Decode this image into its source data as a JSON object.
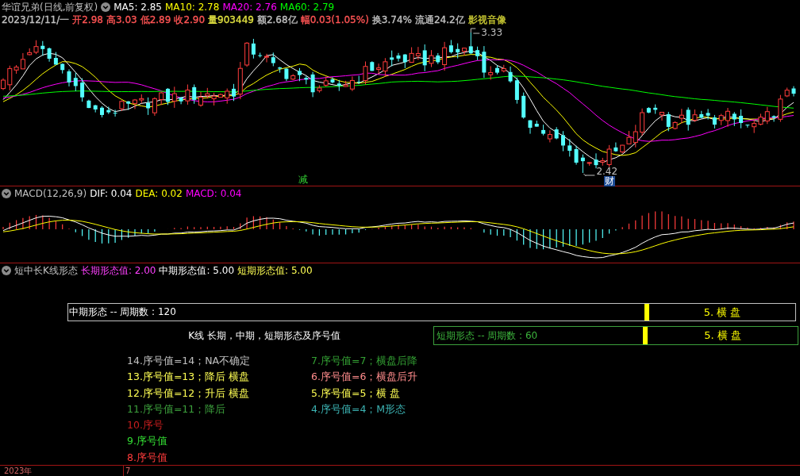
{
  "main_chart": {
    "title": "华谊兄弟(日线,前复权)",
    "indicators": [
      {
        "label": "MA5: 2.85",
        "color": "#ffffff"
      },
      {
        "label": "MA10: 2.78",
        "color": "#ffff00"
      },
      {
        "label": "MA20: 2.76",
        "color": "#ff00ff"
      },
      {
        "label": "MA60: 2.79",
        "color": "#00ff00"
      }
    ],
    "quote": [
      {
        "text": "2023/12/11/一",
        "color": "#c0c0c0"
      },
      {
        "text": "开2.98",
        "color": "#ff5454"
      },
      {
        "text": "高3.03",
        "color": "#ff5454"
      },
      {
        "text": "低2.89",
        "color": "#ff5454"
      },
      {
        "text": "收2.90",
        "color": "#ff5454"
      },
      {
        "text": "量903449",
        "color": "#e0e040"
      },
      {
        "text": "额2.68亿",
        "color": "#c0c0c0"
      },
      {
        "text": "幅0.03(1.05%)",
        "color": "#ff5454"
      },
      {
        "text": "换3.74%",
        "color": "#c0c0c0"
      },
      {
        "text": "流通24.2亿",
        "color": "#c0c0c0"
      },
      {
        "text": "影视音像",
        "color": "#c8c832"
      }
    ],
    "high_label": "3.33",
    "low_label": "2.42",
    "markers": [
      {
        "text": "减",
        "kind": "plain"
      },
      {
        "text": "财",
        "kind": "boxed"
      }
    ]
  },
  "macd": {
    "title": "MACD(12,26,9)",
    "values": [
      {
        "label": "DIF: 0.04",
        "color": "#ffffff"
      },
      {
        "label": "DEA: 0.02",
        "color": "#ffff00"
      },
      {
        "label": "MACD: 0.04",
        "color": "#ff00ff"
      }
    ]
  },
  "pattern": {
    "title": "短中长K线形态",
    "values": [
      {
        "label": "长期形态值: 2.00",
        "color": "#ff40ff"
      },
      {
        "label": "中期形态值: 5.00",
        "color": "#ffffff"
      },
      {
        "label": "短期形态值: 5.00",
        "color": "#ffff54"
      }
    ],
    "medium_box": {
      "label": "中期形态 -- 周期数 : 120",
      "result": "5. 横 盘"
    },
    "caption": "K线 长期，中期，短期形态及序号值",
    "short_box": {
      "label": "短期形态 -- 周期数 : 60",
      "result": "5. 横 盘"
    },
    "legend_left": [
      {
        "text": "14.序号值=14；NA不确定",
        "color": "#c0c0c0"
      },
      {
        "text": "13.序号值=13；降后 横盘",
        "color": "#ffff54"
      },
      {
        "text": "12.序号值=12；升后 横盘",
        "color": "#ffff54"
      },
      {
        "text": "11.序号值=11；降后",
        "color": "#3ca03c"
      },
      {
        "text": "10.序号",
        "color": "#c81e1e"
      },
      {
        "text": "9.序号值",
        "color": "#33dd33"
      },
      {
        "text": "8.序号值",
        "color": "#ff3c3c"
      }
    ],
    "legend_right": [
      {
        "text": "7.序号值=7；横盘后降",
        "color": "#33a033"
      },
      {
        "text": "6.序号值=6；横盘后升",
        "color": "#ff8c8c"
      },
      {
        "text": "5.序号值=5；横 盘",
        "color": "#ffff54"
      },
      {
        "text": "4.序号值=4；M形态",
        "color": "#3cb4b4"
      }
    ]
  },
  "time_axis": [
    "2023年",
    "7"
  ]
}
